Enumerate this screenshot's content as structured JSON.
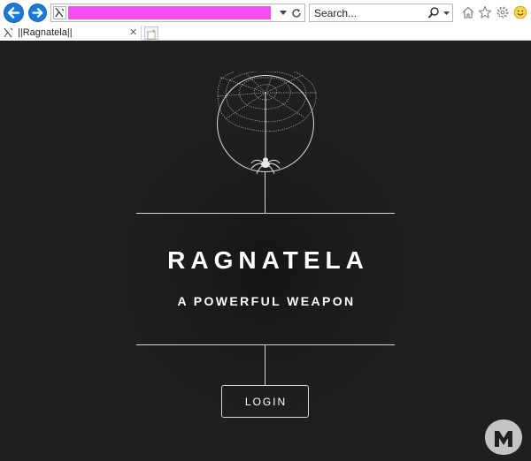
{
  "browser": {
    "search_placeholder": "Search...",
    "tab_title": "||Ragnatela||",
    "tab_close": "✕",
    "icons": {
      "back": "back-arrow-icon",
      "forward": "forward-arrow-icon",
      "address_dropdown": "chevron-down-icon",
      "refresh": "refresh-icon",
      "search": "search-icon",
      "home": "home-icon",
      "favorites": "star-icon",
      "settings": "gear-icon",
      "feedback": "smiley-icon",
      "new_tab": "new-tab-icon"
    },
    "colors": {
      "address_redaction": "#f54cf3",
      "nav_button": "#1b7ad6"
    }
  },
  "page": {
    "title": "RAGNATELA",
    "subtitle": "A POWERFUL WEAPON",
    "login_label": "LOGIN",
    "background": "#1c1e20",
    "foreground": "#ffffff"
  }
}
